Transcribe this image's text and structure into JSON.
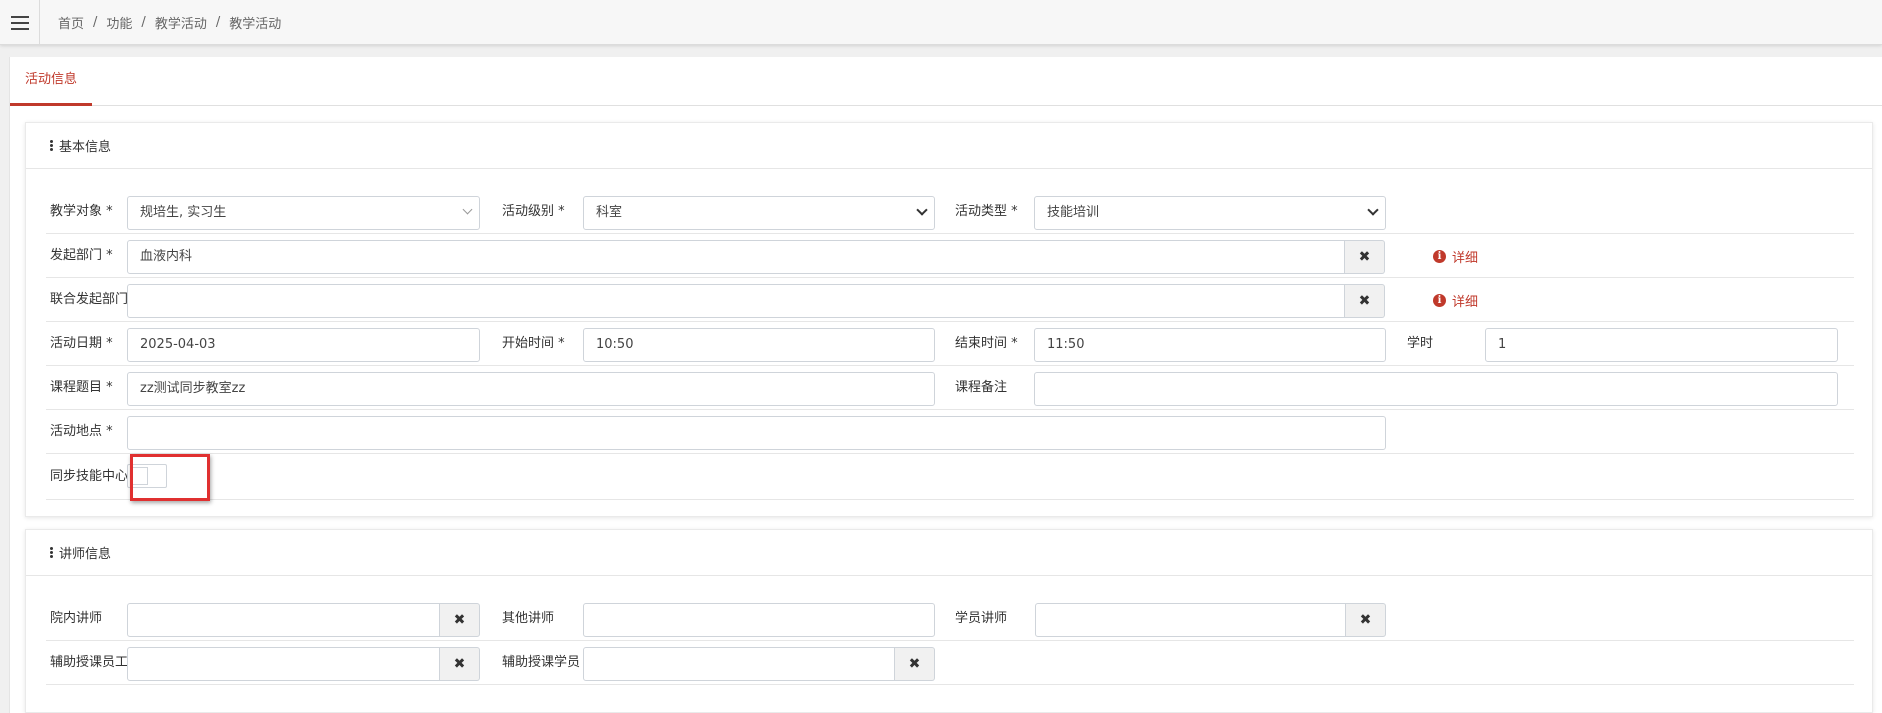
{
  "breadcrumb": {
    "items": [
      "首页",
      "功能",
      "教学活动",
      "教学活动"
    ],
    "separator": "/"
  },
  "tabs": {
    "active_label": "活动信息"
  },
  "colors": {
    "accent": "#c0392b",
    "highlight": "#e03030"
  },
  "basic_info": {
    "title": "基本信息",
    "teaching_target": {
      "label": "教学对象 *",
      "value": "规培生, 实习生"
    },
    "activity_level": {
      "label": "活动级别 *",
      "value": "科室"
    },
    "activity_type": {
      "label": "活动类型 *",
      "value": "技能培训"
    },
    "initiating_dept": {
      "label": "发起部门 *",
      "value": "血液内科",
      "detail": "详细"
    },
    "joint_dept": {
      "label": "联合发起部门",
      "value": "",
      "detail": "详细"
    },
    "activity_date": {
      "label": "活动日期 *",
      "value": "2025-04-03"
    },
    "start_time": {
      "label": "开始时间 *",
      "value": "10:50"
    },
    "end_time": {
      "label": "结束时间 *",
      "value": "11:50"
    },
    "credit_hours": {
      "label": "学时",
      "value": "1"
    },
    "course_title": {
      "label": "课程题目 *",
      "value": "zz测试同步教室zz"
    },
    "course_note": {
      "label": "课程备注",
      "value": ""
    },
    "location": {
      "label": "活动地点 *",
      "value": ""
    },
    "sync_center": {
      "label": "同步技能中心",
      "checked": false
    }
  },
  "lecturer_info": {
    "title": "讲师信息",
    "internal_lecturer": {
      "label": "院内讲师",
      "value": ""
    },
    "other_lecturer": {
      "label": "其他讲师",
      "value": ""
    },
    "student_lecturer": {
      "label": "学员讲师",
      "value": ""
    },
    "assist_staff": {
      "label": "辅助授课员工",
      "value": ""
    },
    "assist_student": {
      "label": "辅助授课学员",
      "value": ""
    }
  },
  "icons": {
    "clear": "times-icon",
    "info": "info-circle-icon",
    "menu": "hamburger-icon"
  }
}
